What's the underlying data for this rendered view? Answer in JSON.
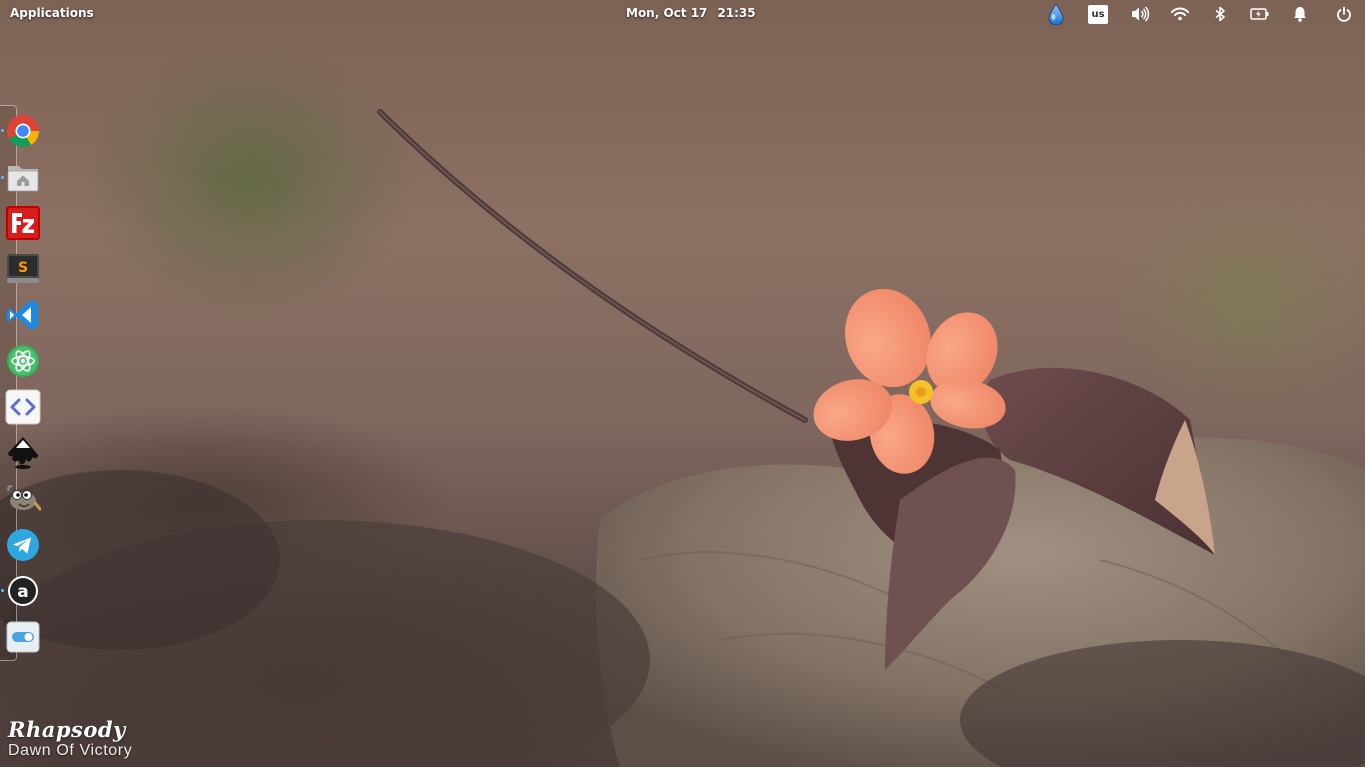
{
  "top_panel": {
    "applications_label": "Applications",
    "clock": {
      "date": "Mon, Oct 17",
      "time": "21:35"
    },
    "indicators": {
      "keyboard_layout": "us",
      "icons": [
        "drop-icon",
        "keyboard-layout-indicator",
        "volume-icon",
        "wifi-icon",
        "bluetooth-icon",
        "battery-icon",
        "notification-bell-icon",
        "power-icon"
      ]
    }
  },
  "dock": {
    "apps": [
      {
        "name": "chrome-icon",
        "running": true
      },
      {
        "name": "files-home-icon",
        "running": true
      },
      {
        "name": "filezilla-icon",
        "running": false
      },
      {
        "name": "sublime-text-icon",
        "running": false
      },
      {
        "name": "visual-studio-code-icon",
        "running": false
      },
      {
        "name": "atom-icon",
        "running": false
      },
      {
        "name": "code-editor-icon",
        "running": false
      },
      {
        "name": "inkscape-icon",
        "running": false
      },
      {
        "name": "gimp-icon",
        "running": false
      },
      {
        "name": "telegram-icon",
        "running": false
      },
      {
        "name": "amazon-icon",
        "running": true
      },
      {
        "name": "toggle-switch-icon",
        "running": false
      }
    ]
  },
  "watermark": {
    "title": "Rhapsody",
    "subtitle": "Dawn Of Victory"
  },
  "colors": {
    "panel_text": "#ffffff",
    "petal": "#f4936f",
    "flower_center": "#f4c12a",
    "leaf": "#5a3b3c",
    "running_dot": "#6fb6ff"
  }
}
